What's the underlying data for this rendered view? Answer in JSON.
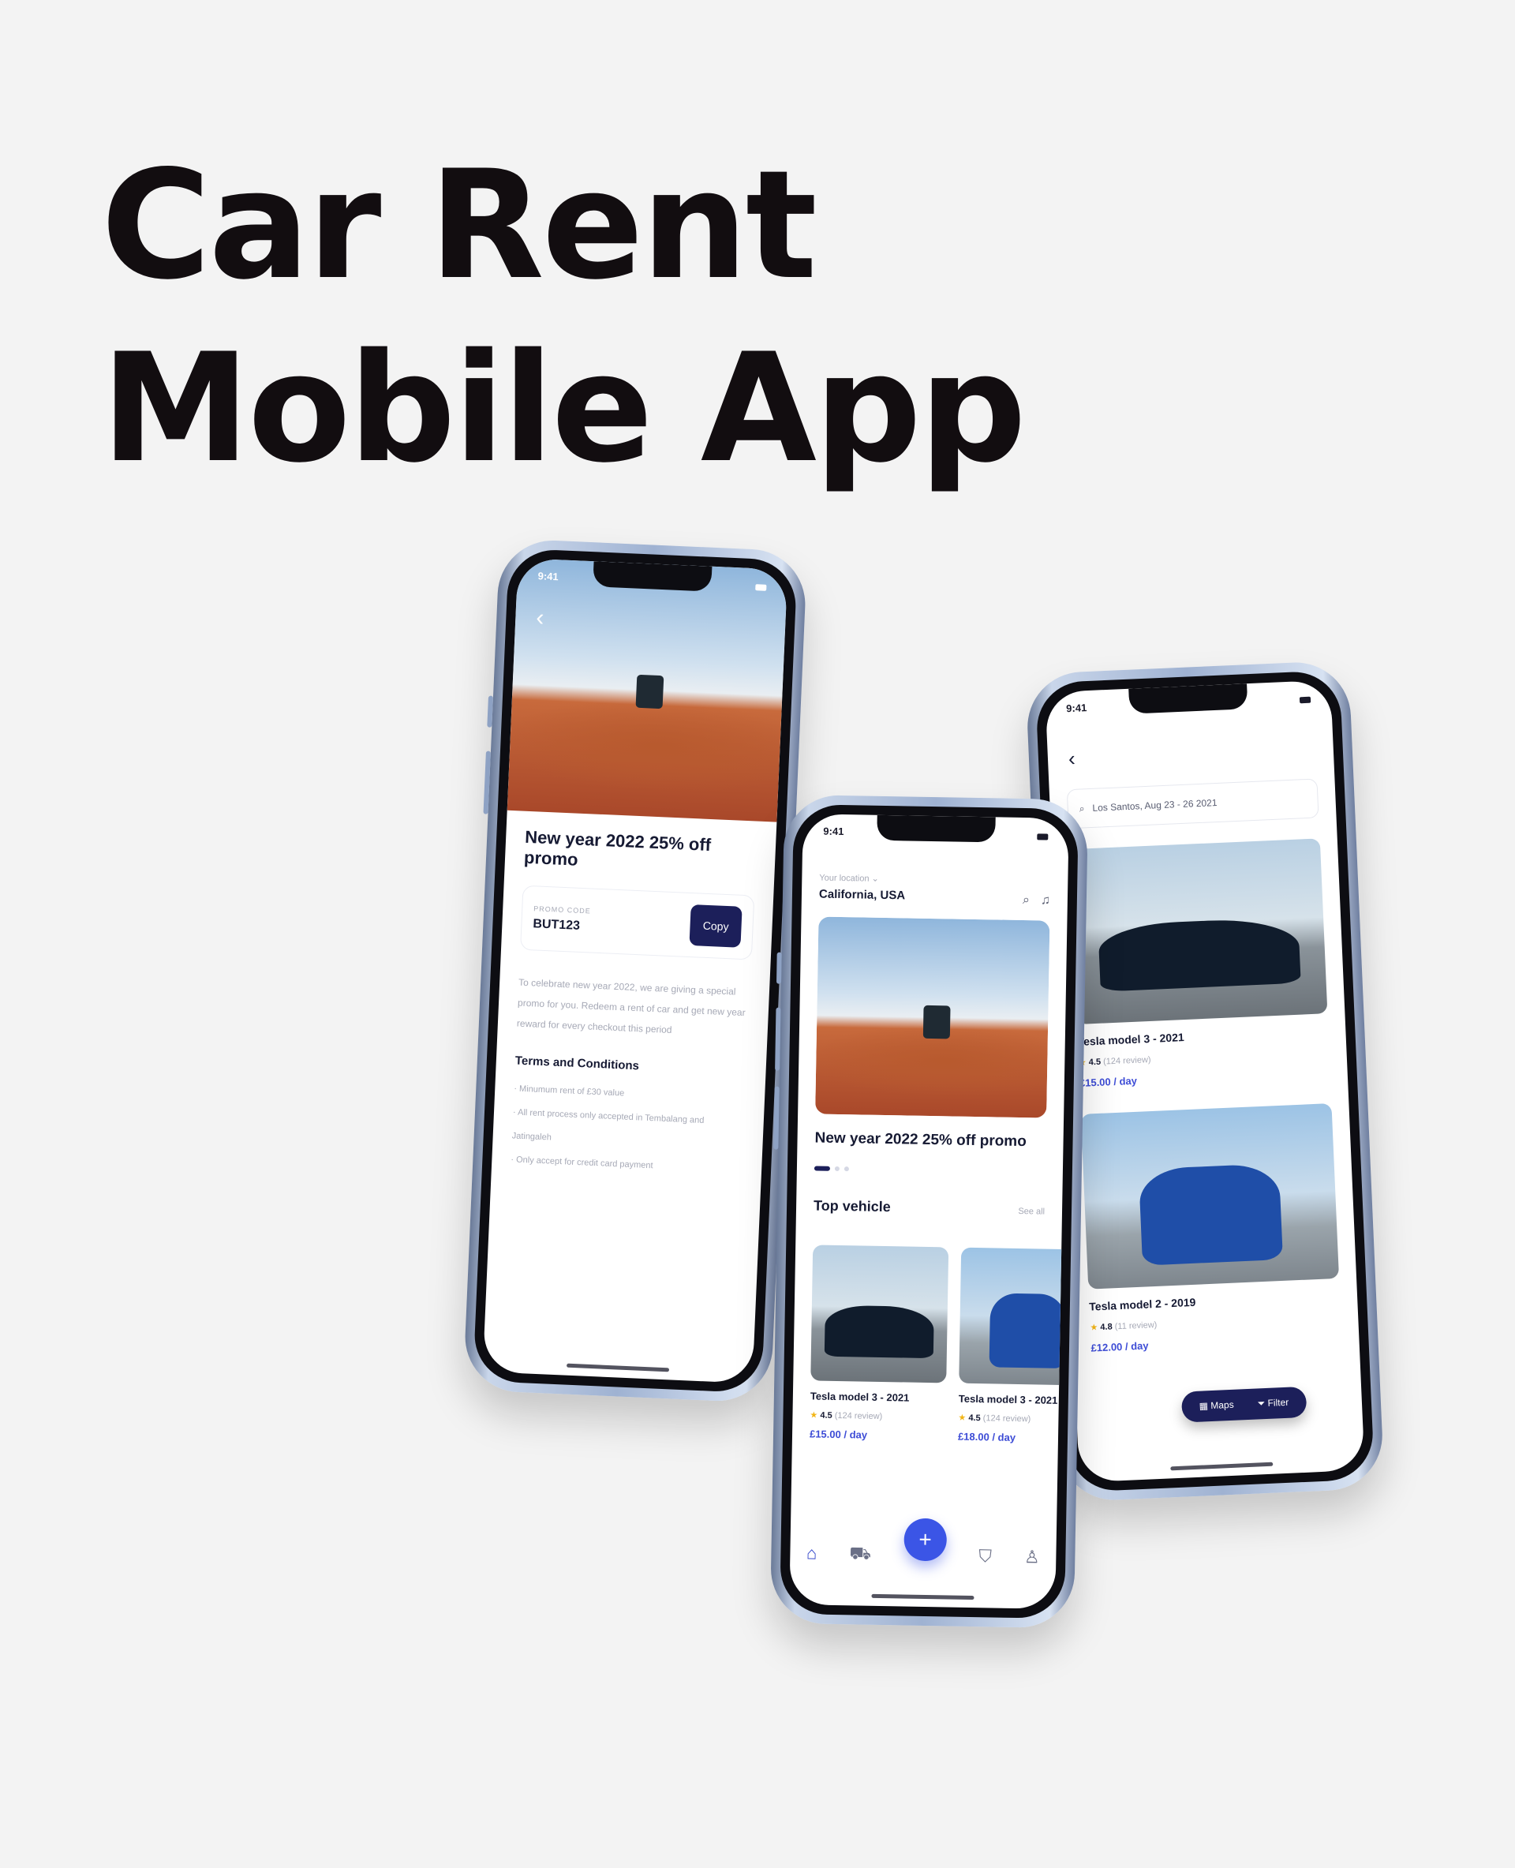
{
  "headline": {
    "line1": "Car Rent",
    "line2": "Mobile App"
  },
  "status": {
    "time": "9:41"
  },
  "promo_detail": {
    "back_icon": "chevron-left-icon",
    "title": "New year 2022 25% off promo",
    "code_label": "PROMO CODE",
    "code_value": "BUT123",
    "copy_label": "Copy",
    "description": "To celebrate new year 2022, we are giving a special promo for you. Redeem a rent of car and get new year reward for every checkout this period",
    "terms_title": "Terms and Conditions",
    "terms": [
      "· Minumum rent of £30 value",
      "· All rent process only accepted in Tembalang and Jatingaleh",
      "· Only accept for credit card payment"
    ]
  },
  "home": {
    "location_label": "Your location",
    "location_value": "California, USA",
    "banner_title": "New year 2022 25% off promo",
    "section_title": "Top vehicle",
    "see_all": "See all",
    "cards": [
      {
        "name": "Tesla model 3 - 2021",
        "rating": "4.5",
        "reviews": "(124 review)",
        "price": "£15.00 / day"
      },
      {
        "name": "Tesla model 3 - 2021",
        "rating": "4.5",
        "reviews": "(124 review)",
        "price": "£18.00 / day"
      }
    ],
    "tab_icons": [
      "home-icon",
      "car-icon",
      "add-icon",
      "ticket-icon",
      "profile-icon"
    ],
    "fab_label": "+"
  },
  "results": {
    "search_text": "Los Santos, Aug 23 - 26 2021",
    "items": [
      {
        "name": "Tesla model 3 - 2021",
        "rating": "4.5",
        "reviews": "(124 review)",
        "price": "£15.00 / day"
      },
      {
        "name": "Tesla model 2 - 2019",
        "rating": "4.8",
        "reviews": "(11 review)",
        "price": "£12.00 / day"
      }
    ],
    "maps_label": "Maps",
    "filter_label": "Filter"
  },
  "colors": {
    "navy": "#1c1f5a",
    "accent": "#3d4cd6",
    "star": "#f2b516"
  }
}
